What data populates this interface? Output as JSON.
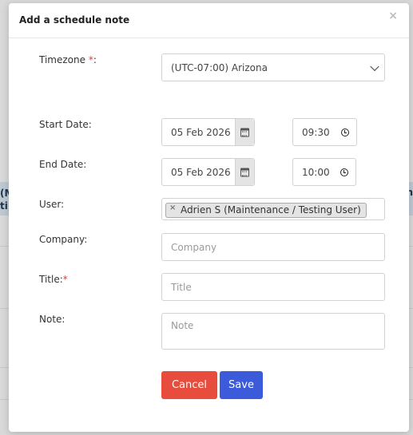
{
  "background": {
    "strip_left_text": "(M\nti",
    "strip_right_text": "n"
  },
  "modal": {
    "title": "Add a schedule note",
    "close_symbol": "×"
  },
  "form": {
    "timezone": {
      "label": "Timezone",
      "required_mark": "*",
      "suffix": ":",
      "value": "(UTC-07:00) Arizona"
    },
    "start_date": {
      "label": "Start Date:",
      "date": "05 Feb 2026",
      "time": "09:30"
    },
    "end_date": {
      "label": "End Date:",
      "date": "05 Feb 2026",
      "time": "10:00"
    },
    "user": {
      "label": "User:",
      "selected": [
        "Adrien S (Maintenance / Testing User)"
      ],
      "remove_symbol": "×"
    },
    "company": {
      "label": "Company:",
      "placeholder": "Company",
      "value": ""
    },
    "title": {
      "label": "Title:",
      "required_mark": "*",
      "placeholder": "Title",
      "value": ""
    },
    "note": {
      "label": "Note:",
      "placeholder": "Note",
      "value": ""
    }
  },
  "buttons": {
    "cancel": "Cancel",
    "save": "Save"
  },
  "colors": {
    "cancel": "#e74c3c",
    "save": "#3b5bdb",
    "required": "#e53935"
  },
  "icons": {
    "date_picker": "calendar-icon",
    "time_picker": "clock-icon",
    "select": "chevron-down-icon",
    "close": "close-icon"
  }
}
